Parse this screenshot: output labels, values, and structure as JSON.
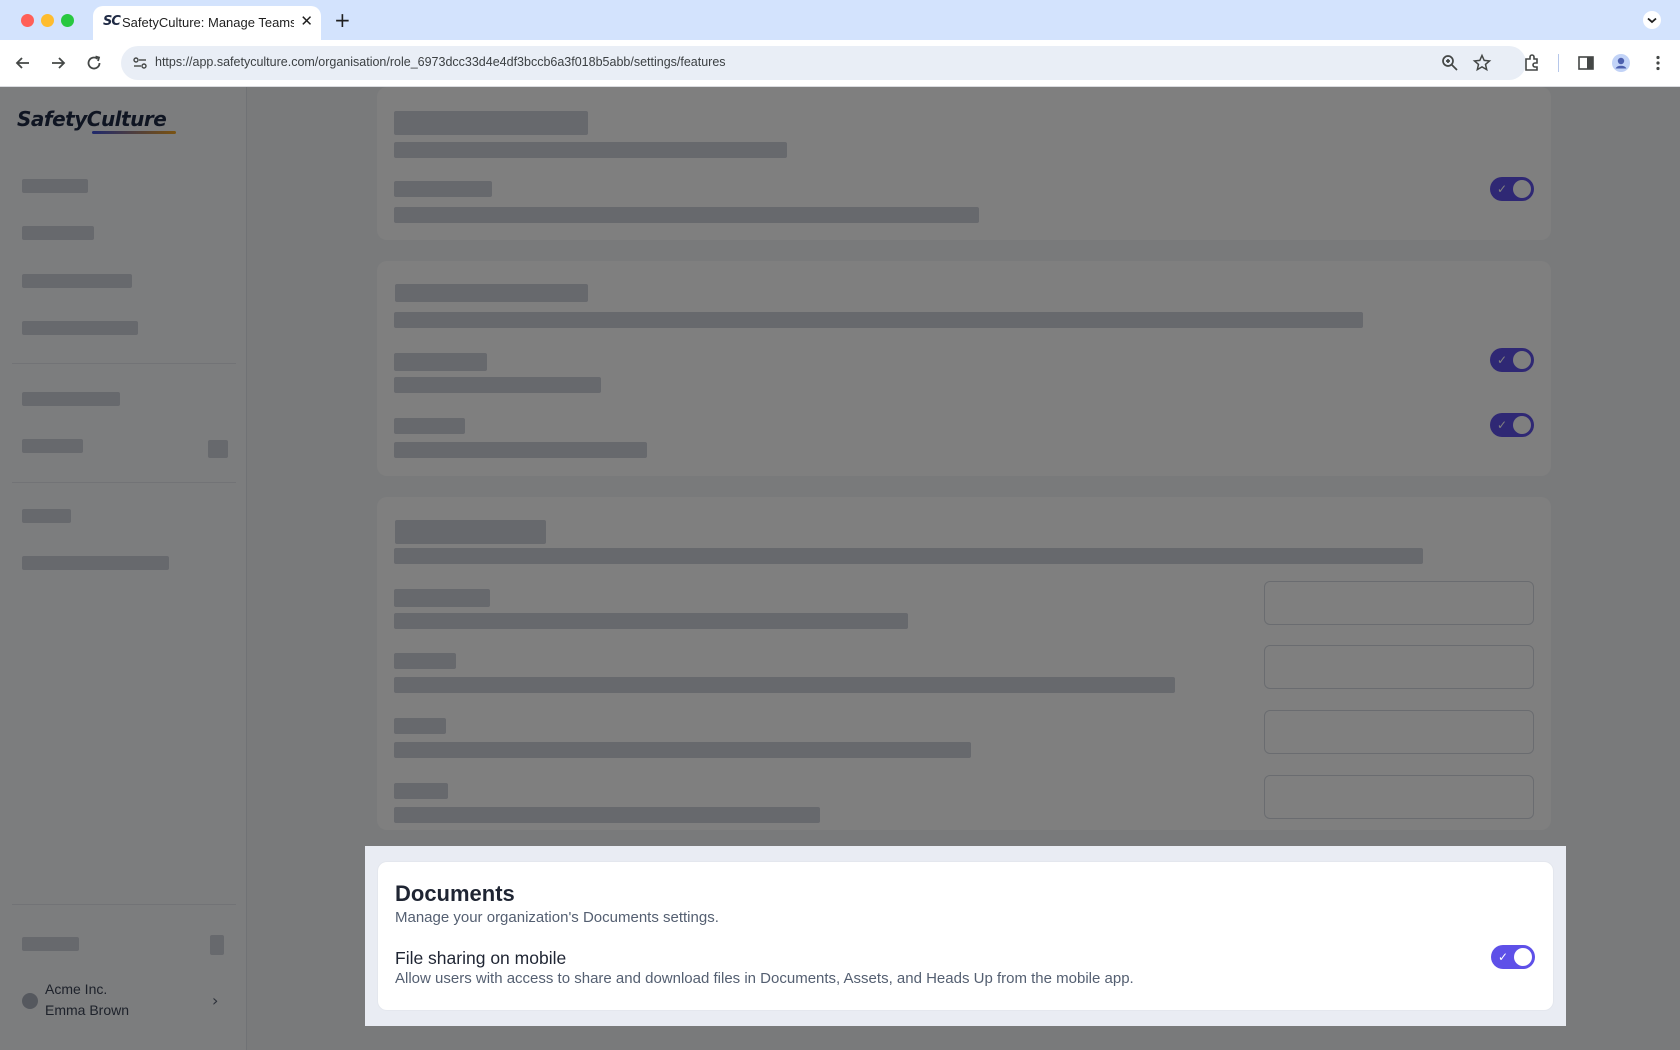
{
  "browser": {
    "tab_title": "SafetyCulture: Manage Teams and...",
    "tab_favicon": "SC",
    "tab_close": "✕",
    "new_tab": "+",
    "url": "https://app.safetyculture.com/organisation/role_6973dcc33d4e4df3bccb6a3f018b5abb/settings/features",
    "icons": [
      "back-icon",
      "forward-icon",
      "reload-icon",
      "site-info-icon",
      "zoom-icon",
      "bookmark-star-icon",
      "extensions-icon",
      "side-panel-icon",
      "profile-icon",
      "kebab-menu-icon",
      "tab-search-icon"
    ]
  },
  "sidebar": {
    "logo": "SafetyCulture",
    "org_name": "Acme Inc.",
    "user_name": "Emma Brown",
    "chevron": "›"
  },
  "documents": {
    "title": "Documents",
    "description": "Manage your organization's Documents settings.",
    "option_label": "File sharing on mobile",
    "option_description": "Allow users with access to share and download files in Documents, Assets, and Heads Up from the mobile app.",
    "toggle_on": true,
    "toggle_check": "✓"
  },
  "colors": {
    "accent": "#5e50e8",
    "overlay": "rgba(0,0,0,0.5)"
  }
}
